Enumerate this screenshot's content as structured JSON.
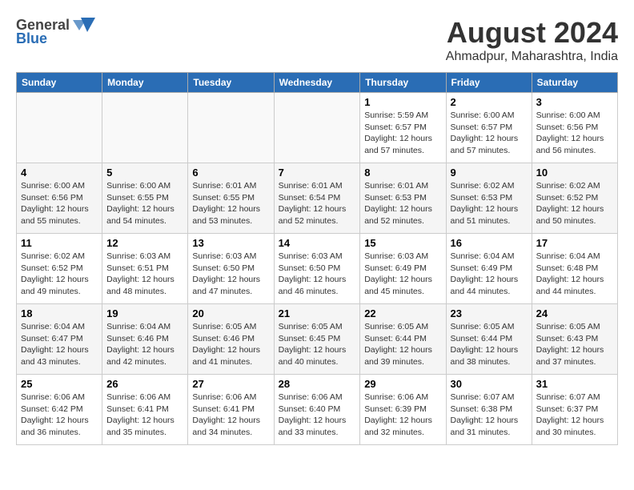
{
  "header": {
    "logo_general": "General",
    "logo_blue": "Blue",
    "month_title": "August 2024",
    "location": "Ahmadpur, Maharashtra, India"
  },
  "weekdays": [
    "Sunday",
    "Monday",
    "Tuesday",
    "Wednesday",
    "Thursday",
    "Friday",
    "Saturday"
  ],
  "weeks": [
    [
      {
        "day": "",
        "info": ""
      },
      {
        "day": "",
        "info": ""
      },
      {
        "day": "",
        "info": ""
      },
      {
        "day": "",
        "info": ""
      },
      {
        "day": "1",
        "sunrise": "Sunrise: 5:59 AM",
        "sunset": "Sunset: 6:57 PM",
        "daylight": "Daylight: 12 hours and 57 minutes."
      },
      {
        "day": "2",
        "sunrise": "Sunrise: 6:00 AM",
        "sunset": "Sunset: 6:57 PM",
        "daylight": "Daylight: 12 hours and 57 minutes."
      },
      {
        "day": "3",
        "sunrise": "Sunrise: 6:00 AM",
        "sunset": "Sunset: 6:56 PM",
        "daylight": "Daylight: 12 hours and 56 minutes."
      }
    ],
    [
      {
        "day": "4",
        "sunrise": "Sunrise: 6:00 AM",
        "sunset": "Sunset: 6:56 PM",
        "daylight": "Daylight: 12 hours and 55 minutes."
      },
      {
        "day": "5",
        "sunrise": "Sunrise: 6:00 AM",
        "sunset": "Sunset: 6:55 PM",
        "daylight": "Daylight: 12 hours and 54 minutes."
      },
      {
        "day": "6",
        "sunrise": "Sunrise: 6:01 AM",
        "sunset": "Sunset: 6:55 PM",
        "daylight": "Daylight: 12 hours and 53 minutes."
      },
      {
        "day": "7",
        "sunrise": "Sunrise: 6:01 AM",
        "sunset": "Sunset: 6:54 PM",
        "daylight": "Daylight: 12 hours and 52 minutes."
      },
      {
        "day": "8",
        "sunrise": "Sunrise: 6:01 AM",
        "sunset": "Sunset: 6:53 PM",
        "daylight": "Daylight: 12 hours and 52 minutes."
      },
      {
        "day": "9",
        "sunrise": "Sunrise: 6:02 AM",
        "sunset": "Sunset: 6:53 PM",
        "daylight": "Daylight: 12 hours and 51 minutes."
      },
      {
        "day": "10",
        "sunrise": "Sunrise: 6:02 AM",
        "sunset": "Sunset: 6:52 PM",
        "daylight": "Daylight: 12 hours and 50 minutes."
      }
    ],
    [
      {
        "day": "11",
        "sunrise": "Sunrise: 6:02 AM",
        "sunset": "Sunset: 6:52 PM",
        "daylight": "Daylight: 12 hours and 49 minutes."
      },
      {
        "day": "12",
        "sunrise": "Sunrise: 6:03 AM",
        "sunset": "Sunset: 6:51 PM",
        "daylight": "Daylight: 12 hours and 48 minutes."
      },
      {
        "day": "13",
        "sunrise": "Sunrise: 6:03 AM",
        "sunset": "Sunset: 6:50 PM",
        "daylight": "Daylight: 12 hours and 47 minutes."
      },
      {
        "day": "14",
        "sunrise": "Sunrise: 6:03 AM",
        "sunset": "Sunset: 6:50 PM",
        "daylight": "Daylight: 12 hours and 46 minutes."
      },
      {
        "day": "15",
        "sunrise": "Sunrise: 6:03 AM",
        "sunset": "Sunset: 6:49 PM",
        "daylight": "Daylight: 12 hours and 45 minutes."
      },
      {
        "day": "16",
        "sunrise": "Sunrise: 6:04 AM",
        "sunset": "Sunset: 6:49 PM",
        "daylight": "Daylight: 12 hours and 44 minutes."
      },
      {
        "day": "17",
        "sunrise": "Sunrise: 6:04 AM",
        "sunset": "Sunset: 6:48 PM",
        "daylight": "Daylight: 12 hours and 44 minutes."
      }
    ],
    [
      {
        "day": "18",
        "sunrise": "Sunrise: 6:04 AM",
        "sunset": "Sunset: 6:47 PM",
        "daylight": "Daylight: 12 hours and 43 minutes."
      },
      {
        "day": "19",
        "sunrise": "Sunrise: 6:04 AM",
        "sunset": "Sunset: 6:46 PM",
        "daylight": "Daylight: 12 hours and 42 minutes."
      },
      {
        "day": "20",
        "sunrise": "Sunrise: 6:05 AM",
        "sunset": "Sunset: 6:46 PM",
        "daylight": "Daylight: 12 hours and 41 minutes."
      },
      {
        "day": "21",
        "sunrise": "Sunrise: 6:05 AM",
        "sunset": "Sunset: 6:45 PM",
        "daylight": "Daylight: 12 hours and 40 minutes."
      },
      {
        "day": "22",
        "sunrise": "Sunrise: 6:05 AM",
        "sunset": "Sunset: 6:44 PM",
        "daylight": "Daylight: 12 hours and 39 minutes."
      },
      {
        "day": "23",
        "sunrise": "Sunrise: 6:05 AM",
        "sunset": "Sunset: 6:44 PM",
        "daylight": "Daylight: 12 hours and 38 minutes."
      },
      {
        "day": "24",
        "sunrise": "Sunrise: 6:05 AM",
        "sunset": "Sunset: 6:43 PM",
        "daylight": "Daylight: 12 hours and 37 minutes."
      }
    ],
    [
      {
        "day": "25",
        "sunrise": "Sunrise: 6:06 AM",
        "sunset": "Sunset: 6:42 PM",
        "daylight": "Daylight: 12 hours and 36 minutes."
      },
      {
        "day": "26",
        "sunrise": "Sunrise: 6:06 AM",
        "sunset": "Sunset: 6:41 PM",
        "daylight": "Daylight: 12 hours and 35 minutes."
      },
      {
        "day": "27",
        "sunrise": "Sunrise: 6:06 AM",
        "sunset": "Sunset: 6:41 PM",
        "daylight": "Daylight: 12 hours and 34 minutes."
      },
      {
        "day": "28",
        "sunrise": "Sunrise: 6:06 AM",
        "sunset": "Sunset: 6:40 PM",
        "daylight": "Daylight: 12 hours and 33 minutes."
      },
      {
        "day": "29",
        "sunrise": "Sunrise: 6:06 AM",
        "sunset": "Sunset: 6:39 PM",
        "daylight": "Daylight: 12 hours and 32 minutes."
      },
      {
        "day": "30",
        "sunrise": "Sunrise: 6:07 AM",
        "sunset": "Sunset: 6:38 PM",
        "daylight": "Daylight: 12 hours and 31 minutes."
      },
      {
        "day": "31",
        "sunrise": "Sunrise: 6:07 AM",
        "sunset": "Sunset: 6:37 PM",
        "daylight": "Daylight: 12 hours and 30 minutes."
      }
    ]
  ]
}
